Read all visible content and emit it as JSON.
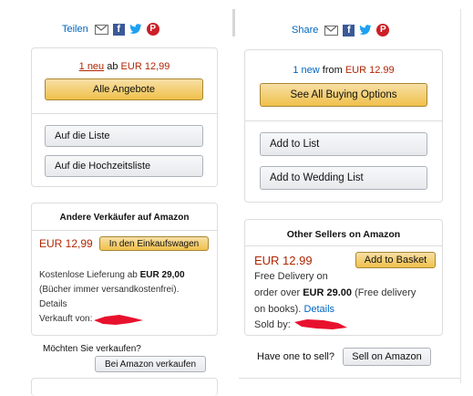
{
  "left": {
    "share": {
      "label": "Teilen",
      "icons": [
        "mail-icon",
        "facebook-icon",
        "twitter-icon",
        "pinterest-icon"
      ]
    },
    "offer": {
      "count": "1 neu",
      "middle": "ab",
      "price": "EUR 12,99"
    },
    "all_offers_button": "Alle Angebote",
    "list_button": "Auf die Liste",
    "wedding_button": "Auf die Hochzeitsliste",
    "other_sellers": {
      "title": "Andere Verkäufer auf Amazon",
      "price": "EUR 12,99",
      "cart_button": "In den Einkaufswagen",
      "delivery_prefix": "Kostenlose Lieferung ab",
      "delivery_amount": "EUR 29,00",
      "delivery_note": "(Bücher immer versandkostenfrei).",
      "details": "Details",
      "sold_by": "Verkauft von:"
    },
    "sell_prompt": "Möchten Sie verkaufen?",
    "sell_button": "Bei Amazon verkaufen"
  },
  "right": {
    "share": {
      "label": "Share",
      "icons": [
        "mail-icon",
        "facebook-icon",
        "twitter-icon",
        "pinterest-icon"
      ]
    },
    "offer": {
      "count": "1 new",
      "middle": "from",
      "price": "EUR 12.99"
    },
    "all_offers_button": "See All Buying Options",
    "list_button": "Add to List",
    "wedding_button": "Add to Wedding List",
    "other_sellers": {
      "title": "Other Sellers on Amazon",
      "price": "EUR 12.99",
      "cart_button": "Add to Basket",
      "delivery_line1": "Free Delivery on",
      "delivery_line2_prefix": "order over",
      "delivery_amount": "EUR 29.00",
      "delivery_line2_suffix": "(Free delivery",
      "delivery_line3_prefix": "on books).",
      "details": "Details",
      "sold_by": "Sold by:"
    },
    "sell_prompt": "Have one to sell?",
    "sell_button": "Sell on Amazon"
  },
  "colors": {
    "link": "#0066c0",
    "price": "#b12704",
    "button_yellow": "#f0c14b",
    "redaction": "#e8112d"
  }
}
